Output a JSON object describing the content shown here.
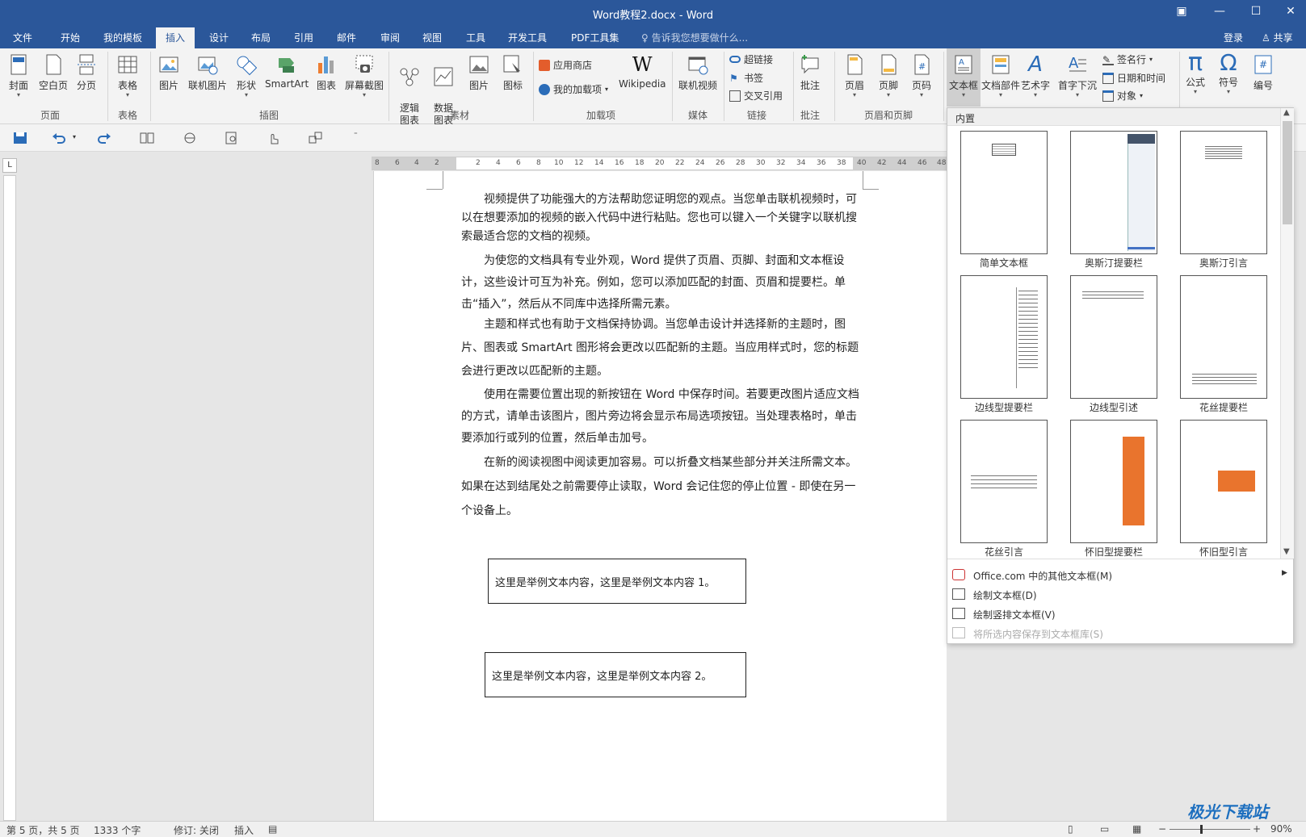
{
  "window": {
    "title": "Word教程2.docx - Word"
  },
  "tabs": [
    {
      "label": "文件"
    },
    {
      "label": "开始"
    },
    {
      "label": "我的模板"
    },
    {
      "label": "插入"
    },
    {
      "label": "设计"
    },
    {
      "label": "布局"
    },
    {
      "label": "引用"
    },
    {
      "label": "邮件"
    },
    {
      "label": "审阅"
    },
    {
      "label": "视图"
    },
    {
      "label": "工具"
    },
    {
      "label": "开发工具"
    },
    {
      "label": "PDF工具集"
    }
  ],
  "search_hint": "告诉我您想要做什么...",
  "account": {
    "login": "登录",
    "share": "共享"
  },
  "ribbon": {
    "pages": {
      "cover": "封面",
      "blank": "空白页",
      "break": "分页",
      "group": "页面"
    },
    "tables": {
      "table": "表格",
      "group": "表格"
    },
    "illustrations": {
      "picture": "图片",
      "online_picture": "联机图片",
      "shapes": "形状",
      "smartart": "SmartArt",
      "chart": "图表",
      "screenshot": "屏幕截图",
      "group": "插图"
    },
    "material": {
      "logic_chart": "逻辑\n图表",
      "data_chart": "数据\n图表",
      "picture": "图片",
      "icon": "图标",
      "group": "素材"
    },
    "addins": {
      "store": "应用商店",
      "my_addins": "我的加载项",
      "wikipedia": "Wikipedia",
      "group": "加载项"
    },
    "media": {
      "online_video": "联机视频",
      "group": "媒体"
    },
    "links": {
      "hyperlink": "超链接",
      "bookmark": "书签",
      "cross_ref": "交叉引用",
      "group": "链接"
    },
    "comments": {
      "comment": "批注",
      "group": "批注"
    },
    "header_footer": {
      "header": "页眉",
      "footer": "页脚",
      "page_number": "页码",
      "group": "页眉和页脚"
    },
    "text": {
      "textbox": "文本框",
      "quick_parts": "文档部件",
      "wordart": "艺术字",
      "dropcap": "首字下沉",
      "signature": "签名行",
      "datetime": "日期和时间",
      "object": "对象"
    },
    "symbols": {
      "equation": "公式",
      "symbol": "符号",
      "numbering": "编号"
    }
  },
  "ruler_ticks": [
    "8",
    "6",
    "4",
    "2",
    "",
    "2",
    "4",
    "6",
    "8",
    "10",
    "12",
    "14",
    "16",
    "18",
    "20",
    "22",
    "24",
    "26",
    "28",
    "30",
    "32",
    "34",
    "36",
    "38",
    "40",
    "42",
    "44",
    "46",
    "48"
  ],
  "document": {
    "paragraphs": [
      "视频提供了功能强大的方法帮助您证明您的观点。当您单击联机视频时，可以在想要添加的视频的嵌入代码中进行粘贴。您也可以键入一个关键字以联机搜索最适合您的文档的视频。",
      "为使您的文档具有专业外观，Word 提供了页眉、页脚、封面和文本框设计，这些设计可互为补充。例如，您可以添加匹配的封面、页眉和提要栏。单击“插入”，然后从不同库中选择所需元素。",
      "主题和样式也有助于文档保持协调。当您单击设计并选择新的主题时，图片、图表或 SmartArt 图形将会更改以匹配新的主题。当应用样式时，您的标题会进行更改以匹配新的主题。",
      "使用在需要位置出现的新按钮在 Word 中保存时间。若要更改图片适应文档的方式，请单击该图片，图片旁边将会显示布局选项按钮。当处理表格时，单击要添加行或列的位置，然后单击加号。",
      "在新的阅读视图中阅读更加容易。可以折叠文档某些部分并关注所需文本。如果在达到结尾处之前需要停止读取，Word 会记住您的停止位置 - 即使在另一个设备上。"
    ],
    "textbox1": "这里是举例文本内容，这里是举例文本内容 1。",
    "textbox2": "这里是举例文本内容，这里是举例文本内容 2。"
  },
  "gallery": {
    "header": "内置",
    "items": [
      {
        "label": "简单文本框"
      },
      {
        "label": "奥斯汀提要栏"
      },
      {
        "label": "奥斯汀引言"
      },
      {
        "label": "边线型提要栏"
      },
      {
        "label": "边线型引述"
      },
      {
        "label": "花丝提要栏"
      },
      {
        "label": "花丝引言"
      },
      {
        "label": "怀旧型提要栏"
      },
      {
        "label": "怀旧型引言"
      }
    ],
    "menu": [
      {
        "label": "Office.com 中的其他文本框(M)",
        "enabled": true
      },
      {
        "label": "绘制文本框(D)",
        "enabled": true
      },
      {
        "label": "绘制竖排文本框(V)",
        "enabled": true
      },
      {
        "label": "将所选内容保存到文本框库(S)",
        "enabled": false
      }
    ]
  },
  "statusbar": {
    "page": "第 5 页，共 5 页",
    "words": "1333 个字",
    "track": "修订: 关闭",
    "mode": "插入",
    "zoom": "90%"
  },
  "watermark": "极光下载站",
  "colors": {
    "accent": "#2b579a",
    "orange": "#e9742d"
  }
}
